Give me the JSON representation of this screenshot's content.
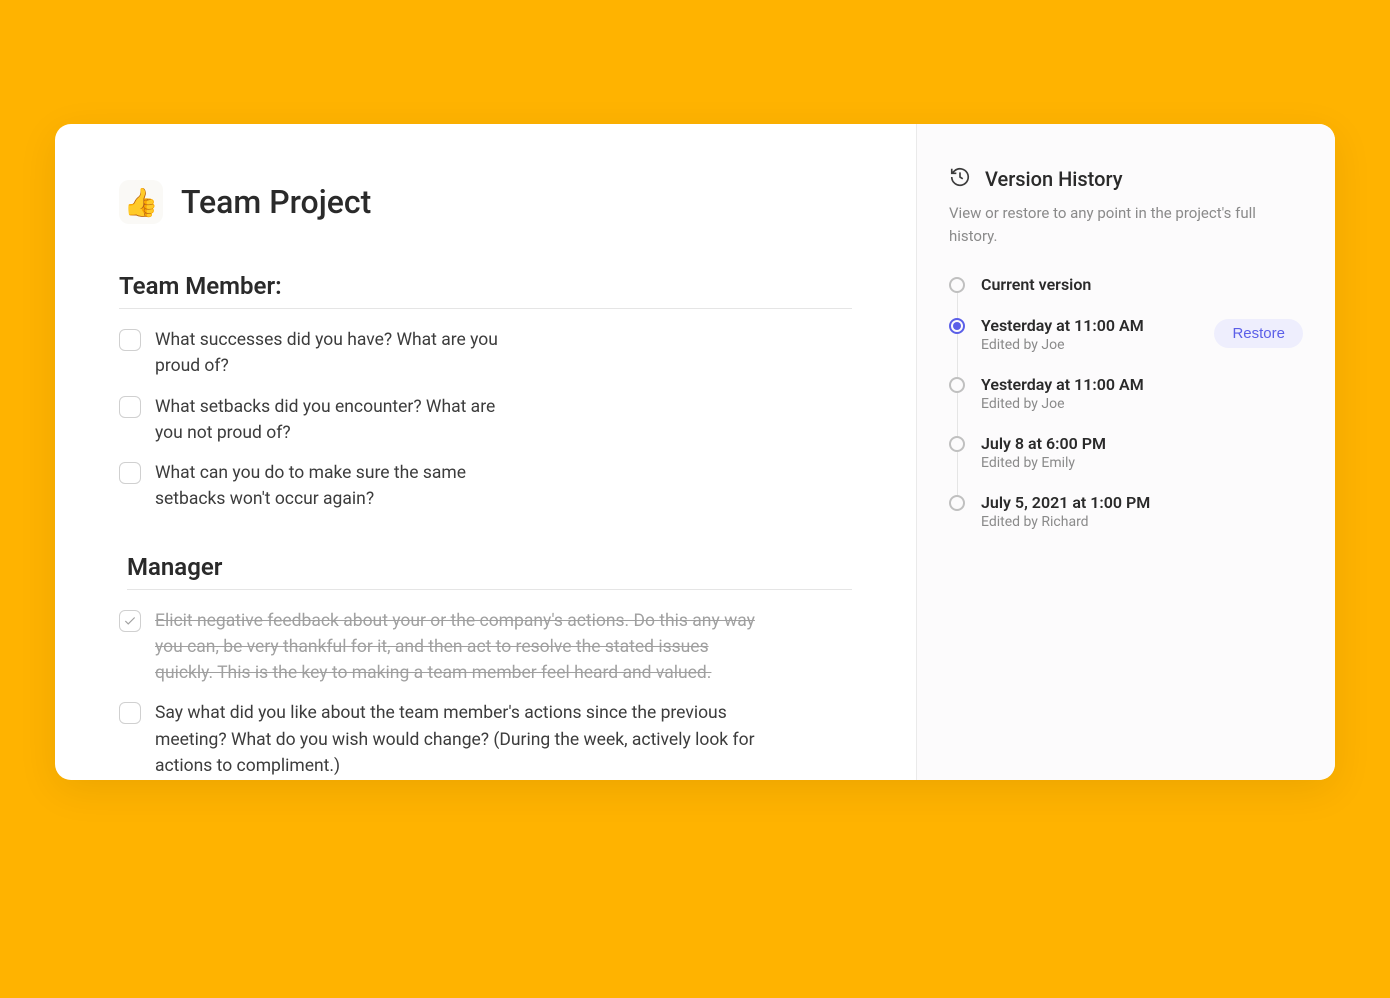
{
  "document": {
    "emoji": "👍",
    "title": "Team Project",
    "sections": [
      {
        "heading": "Team Member:",
        "items": [
          {
            "text": "What successes did you have? What are you proud of?",
            "checked": false
          },
          {
            "text": "What setbacks did you encounter? What are you not proud of?",
            "checked": false
          },
          {
            "text": "What can you do to make sure the same setbacks won't occur again?",
            "checked": false
          }
        ]
      },
      {
        "heading": "Manager",
        "items": [
          {
            "text": "Elicit negative feedback about your or the company's actions. Do this any way you can, be very thankful for it, and then act to resolve the stated issues quickly. This is the key to making a team member feel heard and valued.",
            "checked": true
          },
          {
            "text": "Say what did you like about the team member's actions since the previous meeting? What do you wish would change? (During the week, actively look for actions to compliment.)",
            "checked": false
          }
        ]
      }
    ]
  },
  "sidebar": {
    "title": "Version History",
    "description": "View or restore to any point in the project's full history.",
    "restore_label": "Restore",
    "versions": [
      {
        "label": "Current version",
        "editor": "",
        "selected": false
      },
      {
        "label": "Yesterday at 11:00 AM",
        "editor": "Edited by Joe",
        "selected": true,
        "restorable": true
      },
      {
        "label": "Yesterday at 11:00 AM",
        "editor": "Edited by Joe",
        "selected": false
      },
      {
        "label": "July 8 at 6:00 PM",
        "editor": "Edited by Emily",
        "selected": false
      },
      {
        "label": "July 5, 2021 at 1:00 PM",
        "editor": "Edited by Richard",
        "selected": false
      }
    ]
  }
}
